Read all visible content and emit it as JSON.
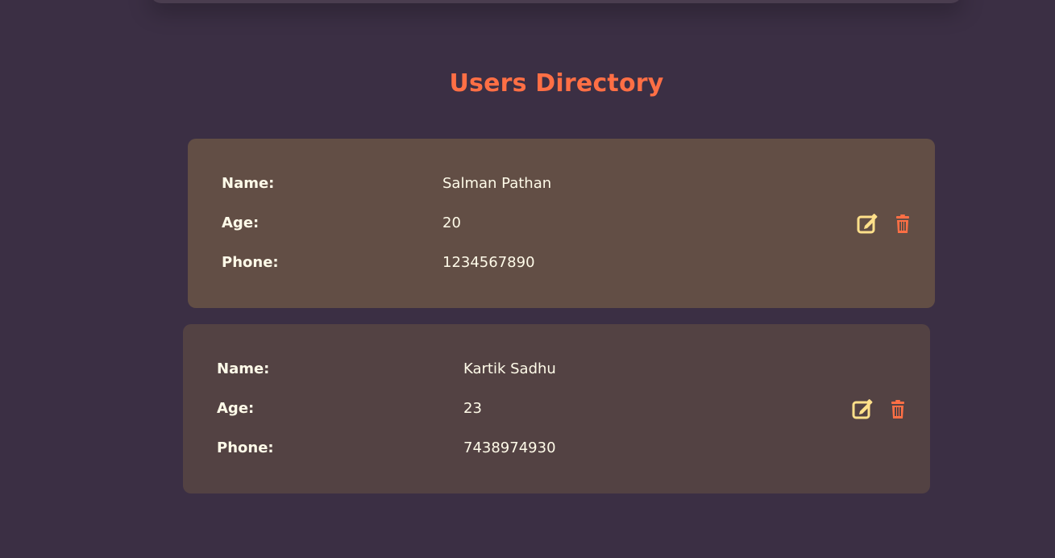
{
  "page": {
    "title": "Users Directory"
  },
  "labels": {
    "name": "Name:",
    "age": "Age:",
    "phone": "Phone:"
  },
  "users": [
    {
      "name": "Salman Pathan",
      "age": "20",
      "phone": "1234567890"
    },
    {
      "name": "Kartik Sadhu",
      "age": "23",
      "phone": "7438974930"
    }
  ],
  "icons": {
    "edit": "edit-icon",
    "delete": "trash-icon"
  },
  "colors": {
    "background": "#3b2f44",
    "title": "#ff6f45",
    "card_primary": "#624e45",
    "card_secondary": "#534243",
    "edit": "#ffe08a",
    "delete": "#ff6f45",
    "text": "#fffbe9"
  }
}
